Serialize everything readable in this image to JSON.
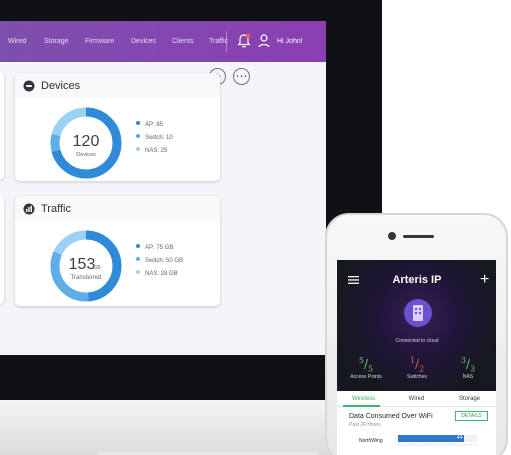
{
  "nav": {
    "items": [
      "Wired",
      "Storage",
      "Firmware",
      "Devices",
      "Clients",
      "Traffic"
    ],
    "greeting": "Hi John!"
  },
  "toolbar": {
    "add_label": "+",
    "more_label": "⋯"
  },
  "devices_card": {
    "title": "Devices",
    "count": "120",
    "caption": "Devices",
    "stats": [
      "AP: 85",
      "Switch: 10",
      "NAS: 25"
    ],
    "colors": [
      "#2f8bd8",
      "#60aee7",
      "#9bd1f2"
    ]
  },
  "traffic_card": {
    "title": "Traffic",
    "value": "153",
    "unit": "GB",
    "caption": "Transferred",
    "stats": [
      "AP: 75 GB",
      "Switch: 50 GB",
      "NAS: 28 GB"
    ],
    "colors": [
      "#2f8bd8",
      "#60aee7",
      "#9bd1f2"
    ]
  },
  "phone": {
    "app_title": "Arteris IP",
    "status": "Connected to cloud",
    "summary": [
      {
        "value": "5",
        "total": "5",
        "label": "Access Points",
        "color": "#66d36e"
      },
      {
        "value": "1",
        "total": "2",
        "label": "Switches",
        "color": "#f05b5b"
      },
      {
        "value": "3",
        "total": "3",
        "label": "NAS",
        "color": "#66d36e"
      }
    ],
    "tabs": [
      "Wireless",
      "Wired",
      "Storage"
    ],
    "section_title": "Data Consumed Over WiFi",
    "section_subtitle": "Past 24 Hours",
    "details_label": "DETAILS",
    "bar": {
      "label": "NorthWing",
      "value": "44",
      "fraction": 0.84
    }
  }
}
